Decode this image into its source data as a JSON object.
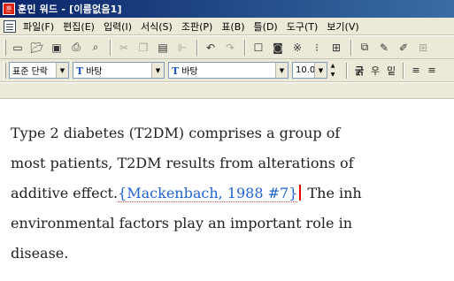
{
  "window": {
    "title": "훈민 워드 - [이름없음1]"
  },
  "menu": [
    "파일(F)",
    "편집(E)",
    "입력(I)",
    "서식(S)",
    "조판(P)",
    "표(B)",
    "틀(D)",
    "도구(T)",
    "보기(V)"
  ],
  "toolbar1": {
    "icons": [
      "new-document-icon",
      "open-folder-icon",
      "save-icon",
      "print-icon",
      "print-preview-icon",
      "cut-icon",
      "copy-icon",
      "paste-icon",
      "format-painter-icon",
      "undo-icon",
      "redo-icon",
      "insert-box-icon",
      "insert-image-icon",
      "special-char-icon",
      "insert-table-icon",
      "columns-icon",
      "highlighter-icon",
      "draw-icon",
      "grid-icon"
    ]
  },
  "toolbar2": {
    "style": "표준 단락",
    "font1": "바탕",
    "font2": "바탕",
    "size": "10.0",
    "bold": "굵",
    "italic": "우",
    "underline": "밑"
  },
  "document": {
    "line1": "Type 2 diabetes (T2DM) comprises a group of",
    "line2": "most patients, T2DM results from alterations of",
    "line3_pre": "additive effect.",
    "citation": "{Mackenbach, 1988 #7}",
    "line3_post": " The inh",
    "line4": "environmental factors play an important role in",
    "line5": "disease."
  }
}
